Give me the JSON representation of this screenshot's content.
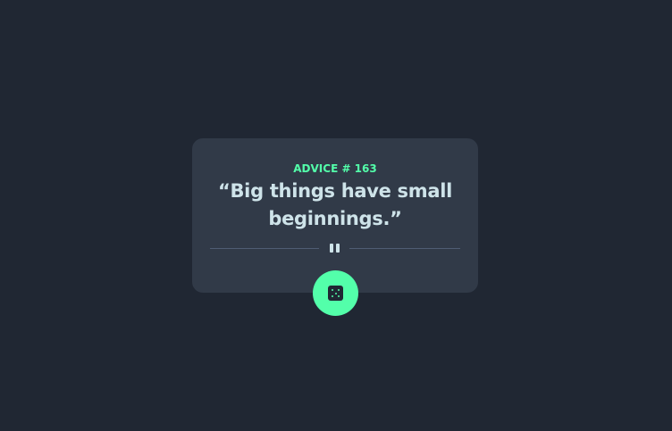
{
  "advice": {
    "label": "ADVICE # 163",
    "quote": "“Big things have small beginnings.”"
  },
  "divider": {
    "icon": "pause-icon"
  },
  "button": {
    "icon": "dice-icon"
  },
  "colors": {
    "background": "#202733",
    "card": "#313a48",
    "accent": "#53ffaa",
    "text": "#cee3e9",
    "divider": "#4f5d74"
  }
}
